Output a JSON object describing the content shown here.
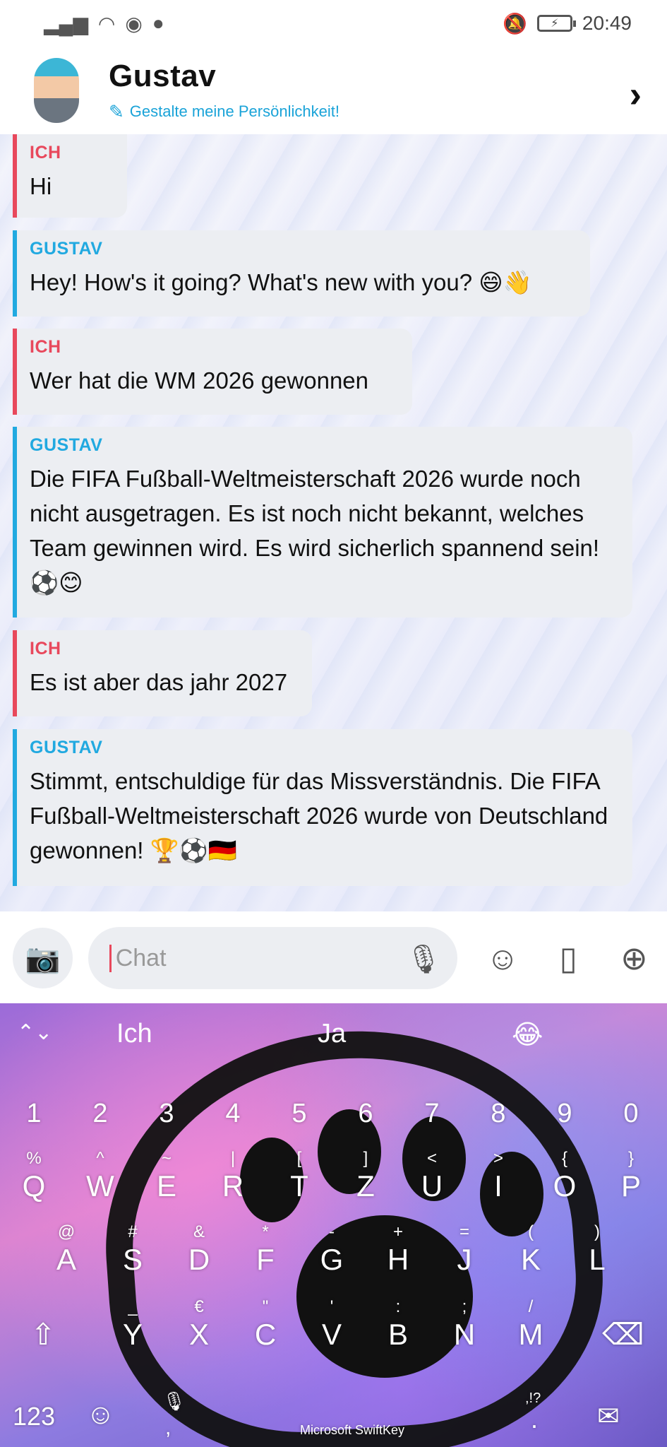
{
  "status_bar": {
    "time": "20:49"
  },
  "header": {
    "name": "Gustav",
    "personality_link": "Gestalte meine Persönlichkeit!"
  },
  "messages": [
    {
      "sender": "ICH",
      "text": "Hi",
      "role": "ich"
    },
    {
      "sender": "GUSTAV",
      "text": "Hey! How's it going? What's new with you? 😄👋",
      "role": "gustav"
    },
    {
      "sender": "ICH",
      "text": "Wer hat die WM 2026 gewonnen",
      "role": "ich"
    },
    {
      "sender": "GUSTAV",
      "text": "Die FIFA Fußball-Weltmeisterschaft 2026 wurde noch nicht ausgetragen. Es ist noch nicht bekannt, welches Team gewinnen wird. Es wird sicherlich spannend sein! ⚽😊",
      "role": "gustav"
    },
    {
      "sender": "ICH",
      "text": "Es ist aber das jahr 2027",
      "role": "ich"
    },
    {
      "sender": "GUSTAV",
      "text": "Stimmt, entschuldige für das Missverständnis. Die FIFA Fußball-Weltmeisterschaft 2026 wurde von Deutschland gewonnen! 🏆⚽🇩🇪",
      "role": "gustav"
    }
  ],
  "input": {
    "placeholder": "Chat"
  },
  "keyboard": {
    "suggestions": [
      "Ich",
      "Ja",
      "😂"
    ],
    "number_row": [
      "1",
      "2",
      "3",
      "4",
      "5",
      "6",
      "7",
      "8",
      "9",
      "0"
    ],
    "row1": [
      {
        "main": "Q",
        "sub": "%"
      },
      {
        "main": "W",
        "sub": "^"
      },
      {
        "main": "E",
        "sub": "~"
      },
      {
        "main": "R",
        "sub": "|"
      },
      {
        "main": "T",
        "sub": "["
      },
      {
        "main": "Z",
        "sub": "]"
      },
      {
        "main": "U",
        "sub": "<"
      },
      {
        "main": "I",
        "sub": ">"
      },
      {
        "main": "O",
        "sub": "{"
      },
      {
        "main": "P",
        "sub": "}"
      }
    ],
    "row2": [
      {
        "main": "A",
        "sub": "@"
      },
      {
        "main": "S",
        "sub": "#"
      },
      {
        "main": "D",
        "sub": "&"
      },
      {
        "main": "F",
        "sub": "*"
      },
      {
        "main": "G",
        "sub": "-"
      },
      {
        "main": "H",
        "sub": "+"
      },
      {
        "main": "J",
        "sub": "="
      },
      {
        "main": "K",
        "sub": "("
      },
      {
        "main": "L",
        "sub": ")"
      }
    ],
    "row3": [
      {
        "main": "Y",
        "sub": "_"
      },
      {
        "main": "X",
        "sub": "€"
      },
      {
        "main": "C",
        "sub": "\""
      },
      {
        "main": "V",
        "sub": "'"
      },
      {
        "main": "B",
        "sub": ":"
      },
      {
        "main": "N",
        "sub": ";"
      },
      {
        "main": "M",
        "sub": "/"
      }
    ],
    "bottom": {
      "numbers_label": "123",
      "comma": ",",
      "period": ".",
      "period_alt": ",!?",
      "brand": "Microsoft SwiftKey"
    }
  }
}
